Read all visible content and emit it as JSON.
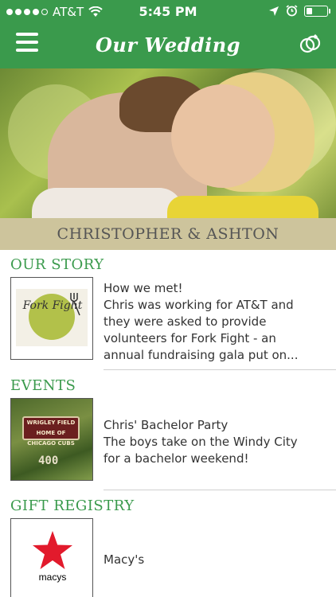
{
  "status_bar": {
    "carrier": "AT&T",
    "time": "5:45 PM",
    "signal_dots_filled": 4,
    "signal_dots_total": 5,
    "battery_level_percent": 20
  },
  "navbar": {
    "title": "Our Wedding",
    "menu_icon": "hamburger-menu-icon",
    "right_icon": "wedding-rings-icon"
  },
  "couple": {
    "names": "CHRISTOPHER & ASHTON"
  },
  "sections": {
    "story": {
      "title": "OUR STORY",
      "item": {
        "thumb_text": "Fork Fight",
        "heading": "How we met!",
        "lines": [
          "Chris was working for AT&T and",
          "they were asked to provide",
          "volunteers for Fork Fight - an",
          "annual fundraising gala put on..."
        ]
      }
    },
    "events": {
      "title": "EVENTS",
      "item": {
        "sign_text": "WRIGLEY FIELD HOME OF CHICAGO CUBS",
        "sign_number": "400",
        "heading": "Chris' Bachelor Party",
        "lines": [
          "The boys take on the Windy City",
          "for a bachelor weekend!"
        ]
      }
    },
    "registry": {
      "title": "GIFT REGISTRY",
      "item": {
        "logo_text": "macys",
        "name": "Macy's"
      }
    }
  },
  "colors": {
    "accent_green": "#3a9a4c",
    "band_tan": "#cdc49c",
    "macys_red": "#e21a2c"
  }
}
